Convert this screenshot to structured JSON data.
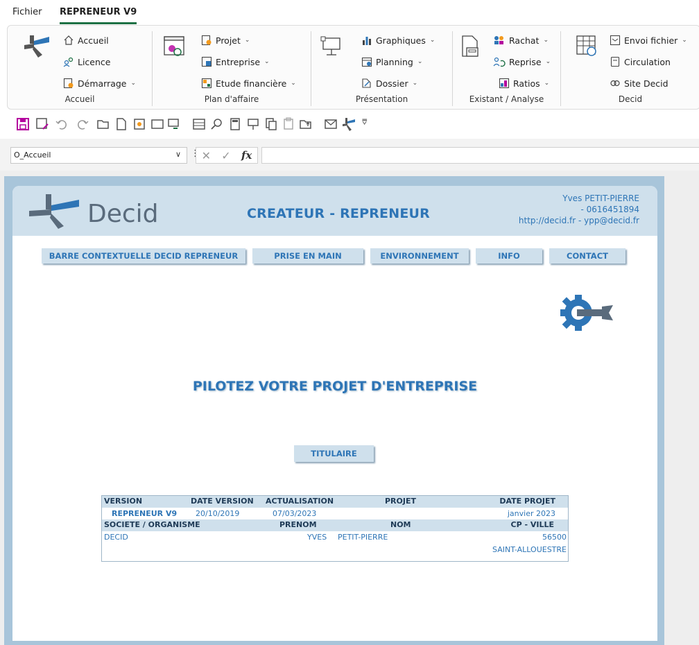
{
  "tabs": {
    "file": "Fichier",
    "active": "REPRENEUR V9"
  },
  "ribbon": {
    "accueil": {
      "items": [
        "Accueil",
        "Licence",
        "Démarrage"
      ],
      "name": "Accueil"
    },
    "plan": {
      "items": [
        "Projet",
        "Entreprise",
        "Etude financière"
      ],
      "name": "Plan d'affaire"
    },
    "presentation": {
      "items": [
        "Graphiques",
        "Planning",
        "Dossier"
      ],
      "name": "Présentation"
    },
    "existant": {
      "items": [
        "Rachat",
        "Reprise",
        "Ratios"
      ],
      "name": "Existant / Analyse"
    },
    "decid": {
      "items": [
        "Envoi fichier",
        "Circulation",
        "Site Decid"
      ],
      "name": "Decid"
    }
  },
  "formula": {
    "namebox": "O_Accueil",
    "fx": "fx"
  },
  "sheet": {
    "logo": "Decid",
    "title": "CREATEUR - REPRENEUR",
    "contact": {
      "name": "Yves PETIT-PIERRE",
      "phone": "- 0616451894",
      "web": "http://decid.fr - ypp@decid.fr"
    },
    "nav": [
      "BARRE CONTEXTUELLE DECID REPRENEUR",
      "PRISE EN MAIN",
      "ENVIRONNEMENT",
      "INFO",
      "CONTACT"
    ],
    "headline": "PILOTEZ VOTRE PROJET D'ENTREPRISE",
    "titulaire": "TITULAIRE",
    "table": {
      "h1": {
        "version": "VERSION",
        "date_version": "DATE VERSION",
        "actualisation": "ACTUALISATION",
        "projet": "PROJET",
        "date_projet": "DATE PROJET"
      },
      "v1": {
        "version": "REPRENEUR V9",
        "date_version": "20/10/2019",
        "actualisation": "07/03/2023",
        "date_projet": "janvier 2023"
      },
      "h2": {
        "societe": "SOCIETE / ORGANISME",
        "prenom": "PRENOM",
        "nom": "NOM",
        "cp": "CP - VILLE"
      },
      "v2": {
        "societe": "DECID",
        "prenom": "YVES",
        "nom": "PETIT-PIERRE",
        "cp": "56500",
        "ville": "SAINT-ALLOUESTRE"
      }
    }
  },
  "colors": {
    "accent": "#2e75b6",
    "header_bg": "#cfe0ec",
    "frame": "#a8c5da",
    "excel_green": "#1e7145",
    "magenta": "#b4009e"
  }
}
